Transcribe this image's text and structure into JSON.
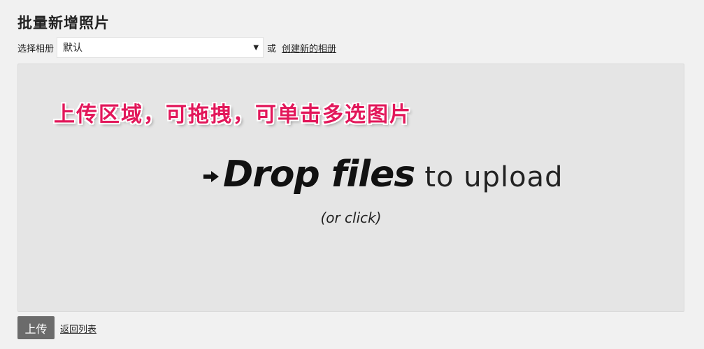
{
  "page": {
    "title": "批量新增照片"
  },
  "album": {
    "label": "选择相册",
    "selected": "默认",
    "or_text": "或",
    "create_link": "创建新的相册"
  },
  "dropzone": {
    "annotation": "上传区域，可拖拽，可单击多选图片",
    "message_strong": "Drop files",
    "message_light": "to upload",
    "or_click": "(or click)",
    "icon": "arrow-right-icon"
  },
  "actions": {
    "upload_label": "上传",
    "back_label": "返回列表"
  }
}
